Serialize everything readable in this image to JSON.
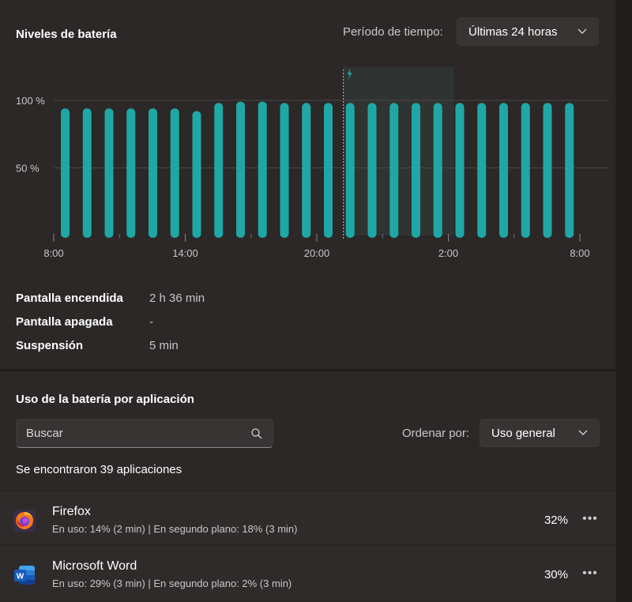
{
  "battery": {
    "title": "Niveles de batería",
    "period_label": "Período de tiempo:",
    "period_value": "Últimas 24 horas"
  },
  "chart_data": {
    "type": "bar",
    "categories": [
      "8:00",
      "9:00",
      "10:00",
      "11:00",
      "12:00",
      "13:00",
      "14:00",
      "15:00",
      "16:00",
      "17:00",
      "18:00",
      "19:00",
      "20:00",
      "21:00",
      "22:00",
      "23:00",
      "0:00",
      "1:00",
      "2:00",
      "3:00",
      "4:00",
      "5:00",
      "6:00",
      "7:00"
    ],
    "values": [
      94,
      94,
      94,
      94,
      94,
      94,
      92,
      98,
      99,
      99,
      98,
      98,
      98,
      98,
      98,
      98,
      98,
      98,
      98,
      98,
      98,
      98,
      98,
      98
    ],
    "ylim": [
      0,
      100
    ],
    "ytick_labels": [
      "100 %",
      "50 %"
    ],
    "xtick_labels": [
      "8:00",
      "14:00",
      "20:00",
      "2:00",
      "8:00"
    ],
    "charging_marker_hour": 13,
    "color": "#1fa7a5",
    "grid": true
  },
  "stats": {
    "screen_on_label": "Pantalla encendida",
    "screen_on_value": "2 h 36 min",
    "screen_off_label": "Pantalla apagada",
    "screen_off_value": "-",
    "sleep_label": "Suspensión",
    "sleep_value": "5 min"
  },
  "usage": {
    "title": "Uso de la batería por aplicación",
    "search_placeholder": "Buscar",
    "sort_label": "Ordenar por:",
    "sort_value": "Uso general",
    "found_text": "Se encontraron 39 aplicaciones"
  },
  "apps": [
    {
      "name": "Firefox",
      "detail": "En uso: 14% (2 min) | En segundo plano: 18% (3 min)",
      "percent": "32%",
      "icon": "firefox-icon"
    },
    {
      "name": "Microsoft Word",
      "detail": "En uso: 29% (3 min) | En segundo plano: 2% (3 min)",
      "percent": "30%",
      "icon": "word-icon"
    }
  ]
}
